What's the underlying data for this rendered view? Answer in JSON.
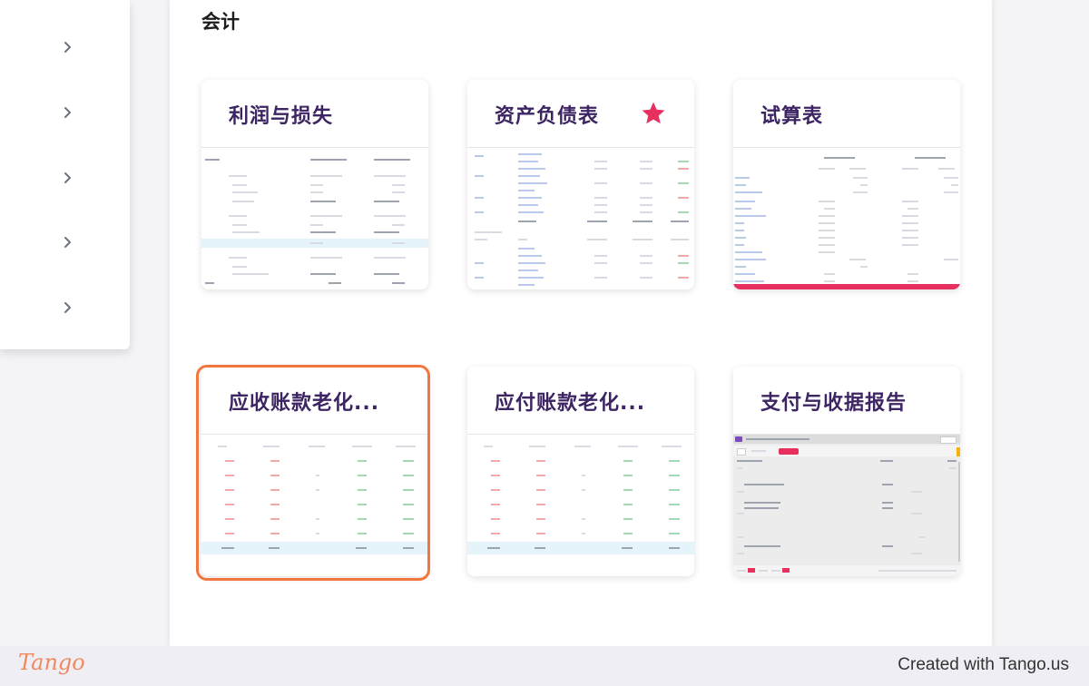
{
  "section": {
    "title": "会计"
  },
  "cards": [
    {
      "title": "利润与损失"
    },
    {
      "title": "资产负债表",
      "favorite": true
    },
    {
      "title": "试算表"
    },
    {
      "title": "应收账款老化..."
    },
    {
      "title": "应付账款老化..."
    },
    {
      "title": "支付与收据报告"
    }
  ],
  "colors": {
    "accent_title": "#3d2563",
    "star": "#e8305e",
    "highlight": "#f2763d"
  },
  "footer": {
    "logo": "Tango",
    "credit": "Created with Tango.us"
  }
}
